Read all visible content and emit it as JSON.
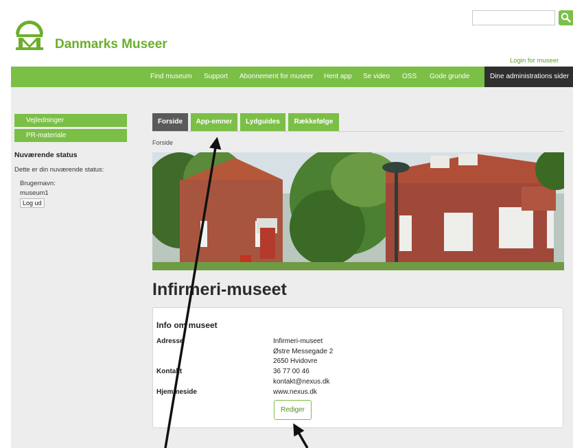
{
  "header": {
    "brand": "Danmarks Museer",
    "search_placeholder": "",
    "login_link": "Login for museer"
  },
  "nav": {
    "items": [
      "Find museum",
      "Support",
      "Abonnement for museer",
      "Hent app",
      "Se video",
      "OSS",
      "Gode grunde"
    ],
    "admin": "Dine administrations sider"
  },
  "sidebar": {
    "items": [
      "Vejledninger",
      "PR-materiale"
    ],
    "status_title": "Nuværende status",
    "status_intro": "Dette er din nuværende status:",
    "username_label": "Brugernavn:",
    "username": "museum1",
    "logout": "Log ud"
  },
  "tabs": [
    "Forside",
    "App-emner",
    "Lydguides",
    "Rækkefølge"
  ],
  "breadcrumb": "Forside",
  "museum": {
    "name": "Infirmeri-museet",
    "info_title": "Info om museet",
    "labels": {
      "address": "Adresse",
      "contact": "Kontakt",
      "homepage": "Hjemmeside"
    },
    "address_lines": [
      "Infirmeri-museet",
      "Østre Messegade 2",
      "2650  Hvidovre"
    ],
    "contact_lines": [
      "36 77 00 46",
      "kontakt@nexus.dk"
    ],
    "homepage": "www.nexus.dk",
    "edit_button": "Rediger"
  },
  "colors": {
    "brand_green": "#7bbf46",
    "dark_tab": "#2f2f2f",
    "active_tab": "#5a5a5a"
  }
}
